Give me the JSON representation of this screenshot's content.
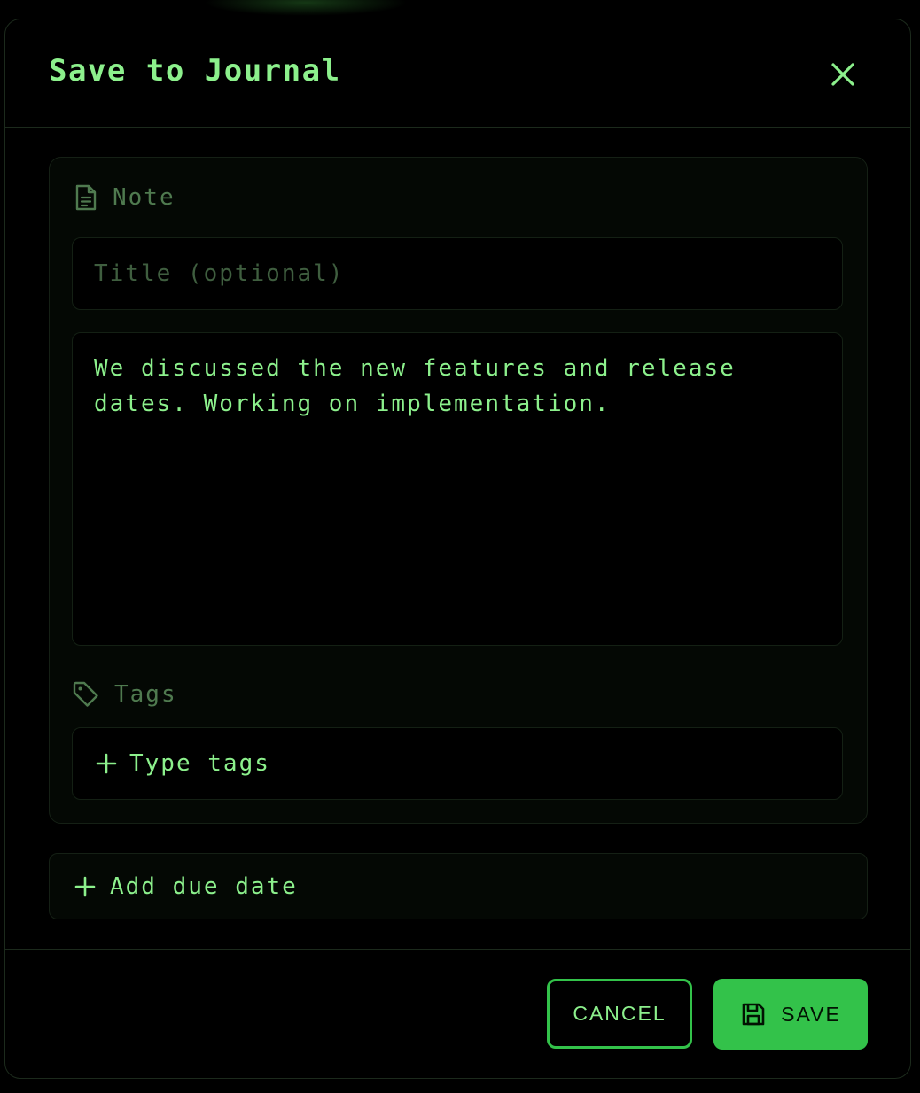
{
  "dialog": {
    "title": "Save to Journal"
  },
  "note": {
    "section_label": "Note",
    "title_placeholder": "Title (optional)",
    "title_value": "",
    "body": "We discussed the new features and release dates. Working on implementation."
  },
  "tags": {
    "section_label": "Tags",
    "input_placeholder": "Type tags"
  },
  "due_date": {
    "label": "Add due date"
  },
  "footer": {
    "cancel_label": "CANCEL",
    "save_label": "SAVE"
  },
  "icons": {
    "close": "close-icon",
    "note": "document-icon",
    "tags": "tag-icon",
    "add": "plus-icon",
    "save": "floppy-disk-icon"
  },
  "colors": {
    "accent": "#8cf08c",
    "primary_button": "#33c24a",
    "muted": "#4f7a4f",
    "background": "#000000"
  }
}
